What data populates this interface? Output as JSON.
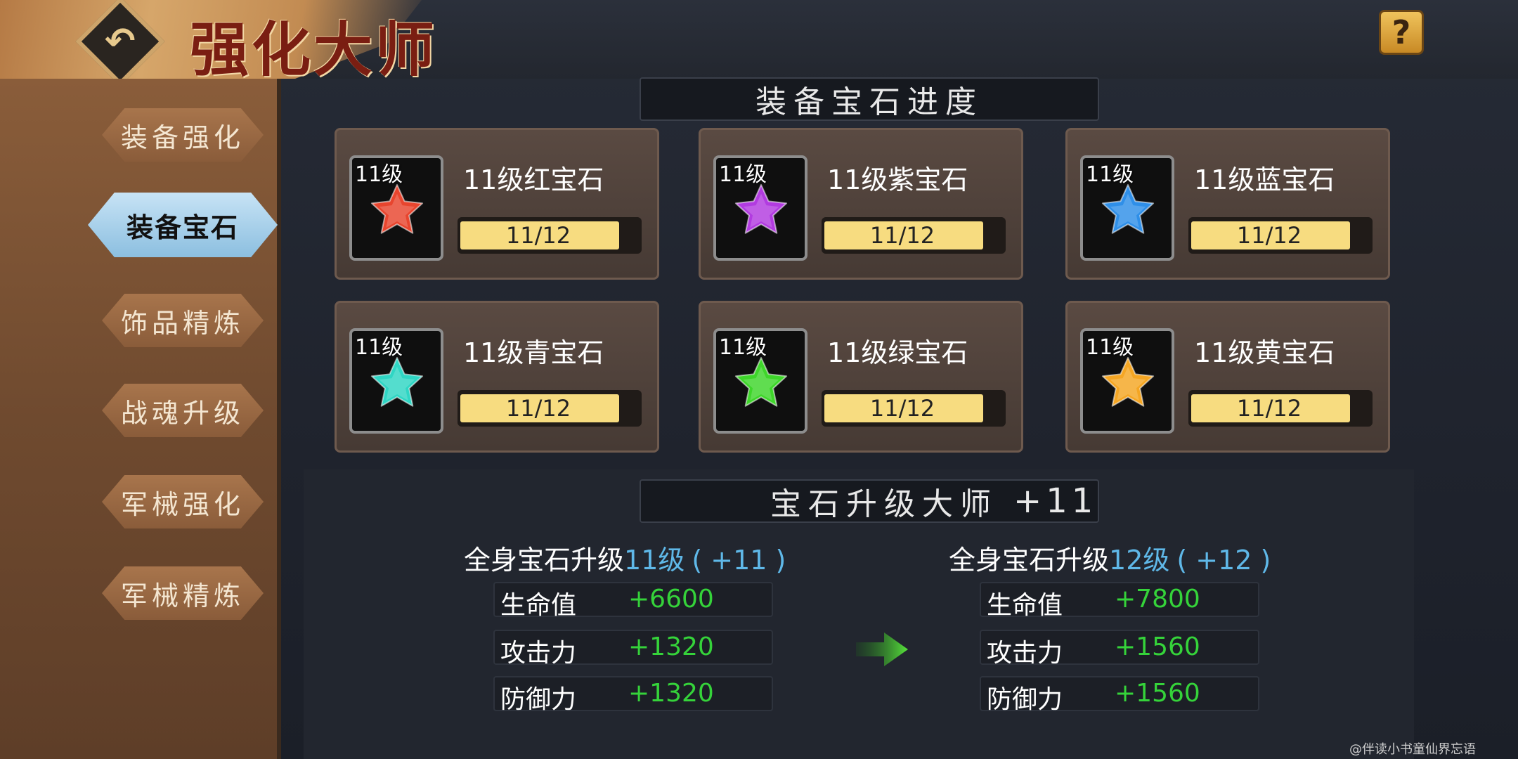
{
  "header": {
    "title": "强化大师",
    "back_icon": "back-arrow-icon",
    "help_label": "?"
  },
  "sidebar": {
    "items": [
      {
        "label": "装备强化",
        "active": false
      },
      {
        "label": "装备宝石",
        "active": true
      },
      {
        "label": "饰品精炼",
        "active": false
      },
      {
        "label": "战魂升级",
        "active": false
      },
      {
        "label": "军械强化",
        "active": false
      },
      {
        "label": "军械精炼",
        "active": false
      }
    ]
  },
  "progress": {
    "header": "装备宝石进度",
    "gems": [
      {
        "level_badge": "11级",
        "name": "11级红宝石",
        "progress": "11/12",
        "fraction": 0.9167,
        "color": "#e8452e"
      },
      {
        "level_badge": "11级",
        "name": "11级紫宝石",
        "progress": "11/12",
        "fraction": 0.9167,
        "color": "#b23be0"
      },
      {
        "level_badge": "11级",
        "name": "11级蓝宝石",
        "progress": "11/12",
        "fraction": 0.9167,
        "color": "#2f8fe8"
      },
      {
        "level_badge": "11级",
        "name": "11级青宝石",
        "progress": "11/12",
        "fraction": 0.9167,
        "color": "#2fd6c4"
      },
      {
        "level_badge": "11级",
        "name": "11级绿宝石",
        "progress": "11/12",
        "fraction": 0.9167,
        "color": "#3ed62a"
      },
      {
        "level_badge": "11级",
        "name": "11级黄宝石",
        "progress": "11/12",
        "fraction": 0.9167,
        "color": "#f5a623"
      }
    ]
  },
  "master": {
    "header": "宝石升级大师",
    "header_value": "+11",
    "current": {
      "title_prefix": "全身宝石升级",
      "title_level": "11级",
      "title_bonus": "( +11 )",
      "stats": [
        {
          "label": "生命值",
          "value": "+6600"
        },
        {
          "label": "攻击力",
          "value": "+1320"
        },
        {
          "label": "防御力",
          "value": "+1320"
        }
      ]
    },
    "next": {
      "title_prefix": "全身宝石升级",
      "title_level": "12级",
      "title_bonus": "( +12 )",
      "stats": [
        {
          "label": "生命值",
          "value": "+7800"
        },
        {
          "label": "攻击力",
          "value": "+1560"
        },
        {
          "label": "防御力",
          "value": "+1560"
        }
      ]
    }
  },
  "watermark": "@伴读小书童仙界忘语"
}
